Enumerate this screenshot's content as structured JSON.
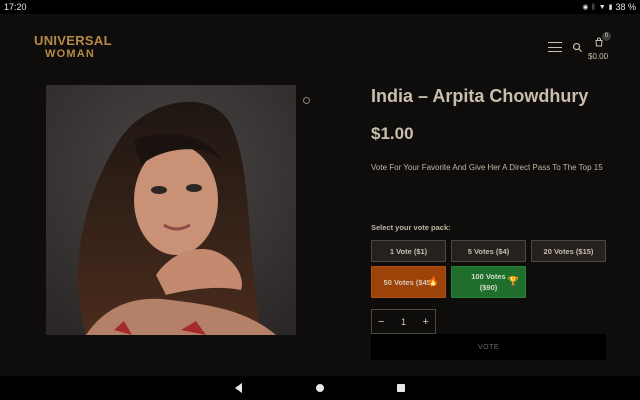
{
  "status_bar": {
    "time": "17:20",
    "battery": "38 %",
    "icons": [
      "eye-icon",
      "bluetooth-icon",
      "wifi-icon",
      "battery-icon"
    ]
  },
  "header": {
    "logo_top": "UNIVERSAL",
    "logo_bottom": "WOMAN",
    "cart_count": "0",
    "cart_total": "$0.00",
    "icons": [
      "menu-icon",
      "search-icon",
      "cart-icon"
    ]
  },
  "product": {
    "image_alt": "India – Arpita Chowdhury",
    "title": "India – Arpita Chowdhury",
    "price": "$1.00",
    "description": "Vote For Your Favorite And Give Her A Direct Pass To The Top 15",
    "pack_label": "Select your vote pack:",
    "packs": [
      {
        "label": "1 Vote ($1)"
      },
      {
        "label": "5 Votes ($4)"
      },
      {
        "label": "20 Votes ($15)"
      },
      {
        "label": "50 Votes ($45)",
        "emoji": "🔥"
      },
      {
        "label": "100 Votes ($90)",
        "emoji": "🏆"
      }
    ],
    "quantity": "1",
    "qty_minus": "−",
    "qty_plus": "+",
    "vote_label": "VOTE"
  },
  "colors": {
    "background": "#0f0d0c",
    "brand_gold": "#b58a47",
    "pack_orange": "#9c4309",
    "pack_green": "#1f6e2b"
  }
}
